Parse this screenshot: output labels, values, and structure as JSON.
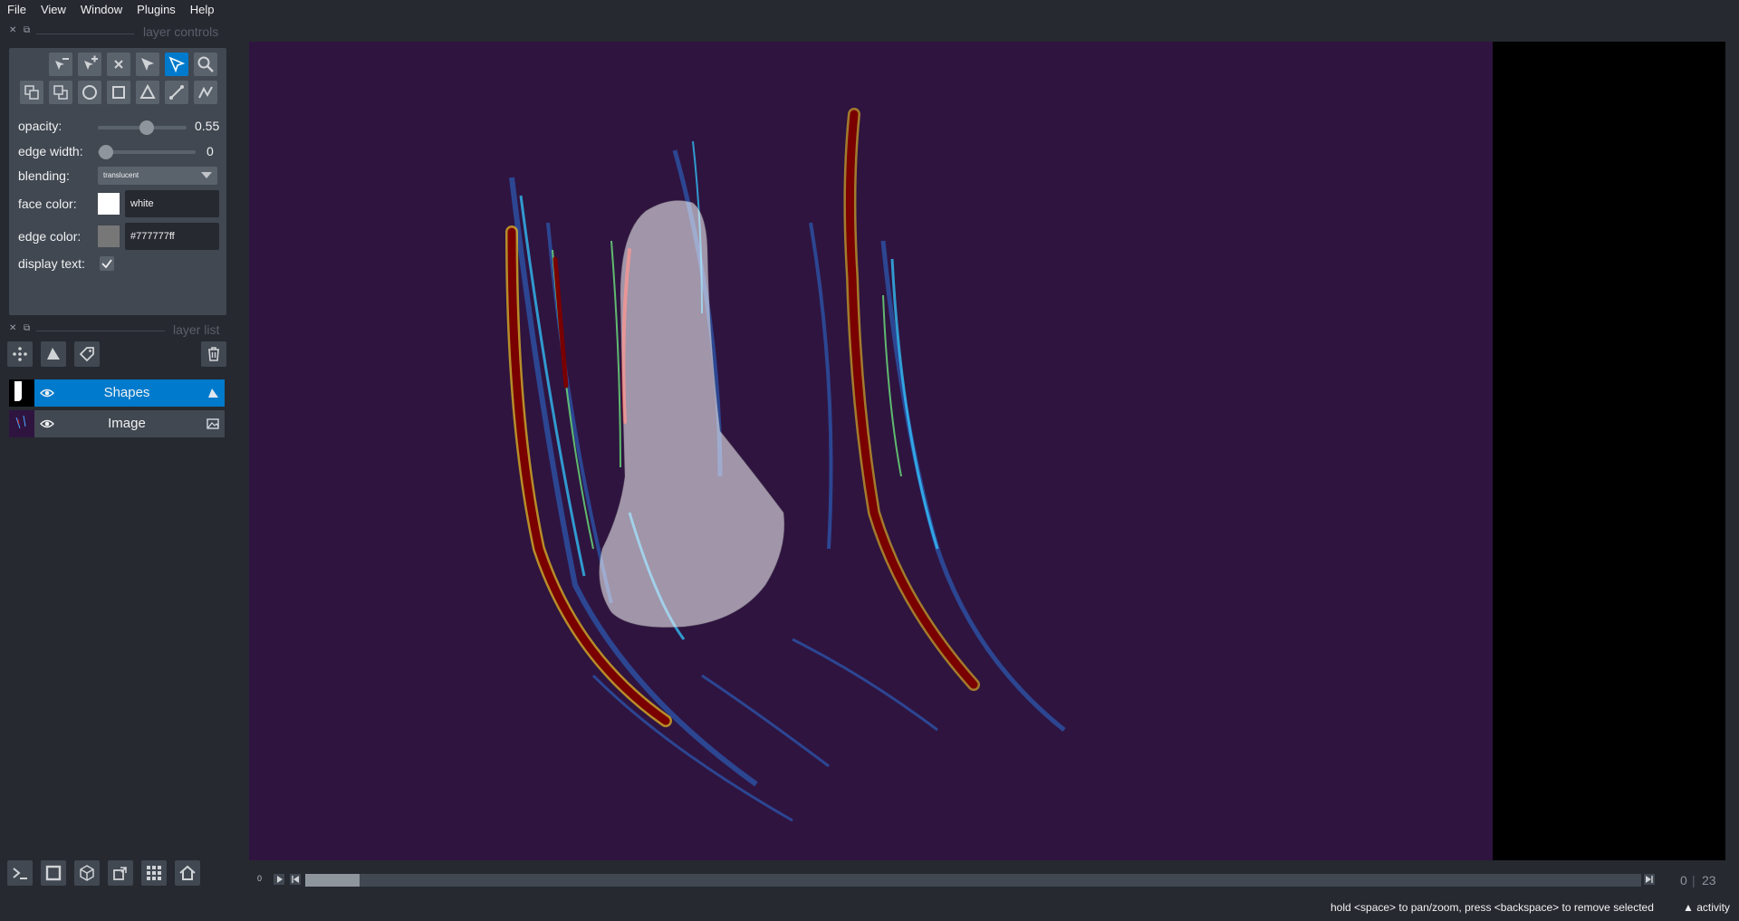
{
  "menu": [
    "File",
    "View",
    "Window",
    "Plugins",
    "Help"
  ],
  "layer_controls": {
    "title": "layer controls",
    "opacity_label": "opacity:",
    "opacity_value": "0.55",
    "opacity_fraction": 0.55,
    "edge_width_label": "edge width:",
    "edge_width_value": "0",
    "blending_label": "blending:",
    "blending_value": "translucent",
    "face_color_label": "face color:",
    "face_color_value": "white",
    "face_color": "#ffffff",
    "edge_color_label": "edge color:",
    "edge_color_value": "#777777ff",
    "edge_color": "#777777",
    "display_text_label": "display text:",
    "display_text_checked": true
  },
  "layer_list": {
    "title": "layer list",
    "layers": [
      {
        "name": "Shapes",
        "selected": true,
        "visible": true,
        "type_icon": "shapes-icon"
      },
      {
        "name": "Image",
        "selected": false,
        "visible": true,
        "type_icon": "image-icon"
      }
    ]
  },
  "dims": {
    "current": "0",
    "total": "23",
    "left_marker": "0"
  },
  "status": {
    "hint": "hold <space> to pan/zoom, press <backspace> to remove selected",
    "activity": "activity"
  },
  "colors": {
    "accent": "#007acc",
    "panel": "#414851",
    "background": "#262930",
    "image_bg": "#2f1440"
  }
}
